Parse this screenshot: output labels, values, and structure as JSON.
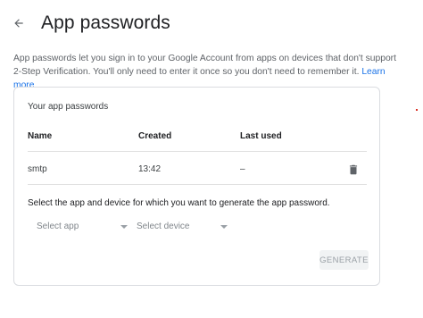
{
  "header": {
    "title": "App passwords"
  },
  "description": {
    "text": "App passwords let you sign in to your Google Account from apps on devices that don't support 2-Step Verification. You'll only need to enter it once so you don't need to remember it. ",
    "link": "Learn more"
  },
  "card": {
    "title": "Your app passwords",
    "columns": {
      "name": "Name",
      "created": "Created",
      "last_used": "Last used"
    },
    "rows": [
      {
        "name": "smtp",
        "created": "13:42",
        "last_used": "–"
      }
    ],
    "generate_prompt": "Select the app and device for which you want to generate the app password.",
    "select_app": "Select app",
    "select_device": "Select device",
    "generate_button": "GENERATE"
  },
  "colors": {
    "link": "#1a73e8",
    "border": "#dadce0",
    "text": "#202124",
    "muted": "#5f6368"
  },
  "icons": {
    "back": "arrow-left-icon",
    "delete": "trash-icon"
  }
}
